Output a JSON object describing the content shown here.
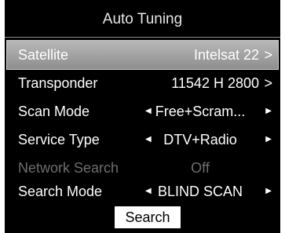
{
  "header": {
    "title": "Auto Tuning"
  },
  "rows": [
    {
      "label": "Satellite",
      "value": "Intelsat 22",
      "control": "arrow"
    },
    {
      "label": "Transponder",
      "value": "11542 H 2800",
      "control": "arrow"
    },
    {
      "label": "Scan Mode",
      "value": "Free+Scram...",
      "control": "spin"
    },
    {
      "label": "Service Type",
      "value": "DTV+Radio",
      "control": "spin"
    },
    {
      "label": "Network Search",
      "value": "Off",
      "control": "disabled"
    },
    {
      "label": "Search Mode",
      "value": "BLIND SCAN",
      "control": "spin"
    }
  ],
  "glyphs": {
    "arrow_right": ">",
    "tri_left": "◀",
    "tri_right": "▶"
  },
  "actions": {
    "search_label": "Search"
  },
  "colors": {
    "background": "#000000",
    "selected_row": "#a8a8a8",
    "disabled_text": "#6e6e6e",
    "button_bg": "#ffffff"
  }
}
